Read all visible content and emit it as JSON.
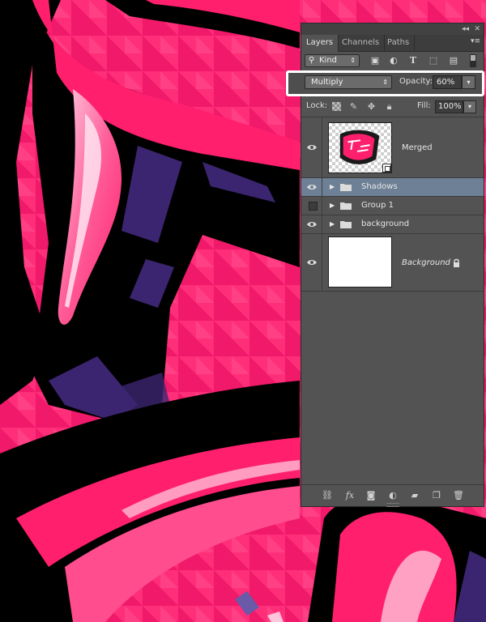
{
  "panel": {
    "tabs": [
      {
        "label": "Layers",
        "active": true
      },
      {
        "label": "Channels",
        "active": false
      },
      {
        "label": "Paths",
        "active": false
      }
    ],
    "filter": {
      "kind_label": "Kind",
      "icons": [
        "image-filter-icon",
        "adjustment-filter-icon",
        "type-filter-icon",
        "shape-filter-icon",
        "smart-object-filter-icon",
        "filter-toggle-icon"
      ]
    },
    "blend": {
      "mode": "Multiply",
      "opacity_label": "Opacity:",
      "opacity_value": "60%"
    },
    "lock": {
      "label": "Lock:",
      "icons": [
        "lock-transparent-icon",
        "lock-image-icon",
        "lock-position-icon",
        "lock-all-icon"
      ],
      "fill_label": "Fill:",
      "fill_value": "100%"
    },
    "layers": [
      {
        "name": "Merged",
        "type": "smart-object",
        "visible": true,
        "selected": false
      },
      {
        "name": "Shadows",
        "type": "group",
        "visible": true,
        "selected": true
      },
      {
        "name": "Group 1",
        "type": "group",
        "visible": false,
        "selected": false
      },
      {
        "name": "background",
        "type": "group",
        "visible": true,
        "selected": false
      },
      {
        "name": "Background",
        "type": "background",
        "visible": true,
        "selected": false,
        "locked": true
      }
    ],
    "footer_icons": [
      "link-layers-icon",
      "fx-icon",
      "add-mask-icon",
      "adjustment-layer-icon",
      "new-group-icon",
      "new-layer-icon",
      "delete-icon"
    ]
  },
  "colors": {
    "artwork_pink": "#ff1f6d",
    "artwork_purple": "#3c2570",
    "selected_layer": "#6d8095",
    "panel_bg": "#535353"
  }
}
